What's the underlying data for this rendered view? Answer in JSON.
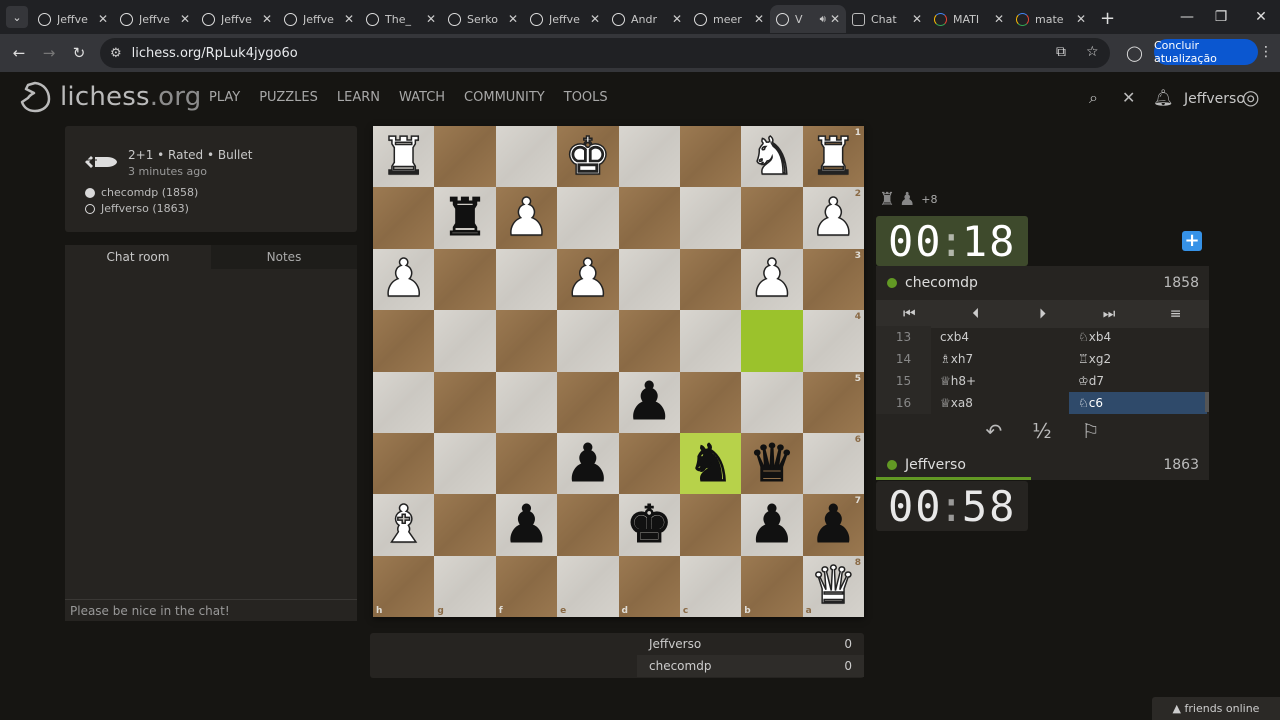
{
  "browser": {
    "tabs": [
      {
        "title": "Jeffve",
        "icon": "lichess-icon"
      },
      {
        "title": "Jeffve",
        "icon": "lichess-icon"
      },
      {
        "title": "Jeffve",
        "icon": "lichess-icon"
      },
      {
        "title": "Jeffve",
        "icon": "lichess-icon"
      },
      {
        "title": "The_",
        "icon": "lichess-icon"
      },
      {
        "title": "Serko",
        "icon": "lichess-icon"
      },
      {
        "title": "Jeffve",
        "icon": "lichess-icon"
      },
      {
        "title": "Andr",
        "icon": "lichess-icon"
      },
      {
        "title": "meer",
        "icon": "lichess-icon"
      },
      {
        "title": "V",
        "icon": "lichess-icon",
        "active": true,
        "audio": true
      },
      {
        "title": "Chat",
        "icon": "chatgpt-icon"
      },
      {
        "title": "MATI",
        "icon": "google-icon"
      },
      {
        "title": "mate",
        "icon": "google-icon"
      }
    ],
    "url": "lichess.org/RpLuk4jygo6o",
    "update_button": "Concluir atualização"
  },
  "site": {
    "logo": "lichess",
    "logo_suffix": ".org",
    "nav": [
      "PLAY",
      "PUZZLES",
      "LEARN",
      "WATCH",
      "COMMUNITY",
      "TOOLS"
    ],
    "username": "Jeffverso"
  },
  "game": {
    "info": "2+1 • Rated • Bullet",
    "time_ago": "3 minutes ago",
    "white_player": "checomdp (1858)",
    "black_player": "Jeffverso (1863)"
  },
  "chat": {
    "tabs": [
      "Chat room",
      "Notes"
    ],
    "placeholder": "Please be nice in the chat!"
  },
  "board": {
    "orientation": "black",
    "ranks": [
      "1",
      "2",
      "3",
      "4",
      "5",
      "6",
      "7",
      "8"
    ],
    "files": [
      "h",
      "g",
      "f",
      "e",
      "d",
      "c",
      "b",
      "a"
    ],
    "squares": [
      [
        "wR",
        "",
        "",
        "wK",
        "",
        "",
        "wN",
        "wR"
      ],
      [
        "",
        "bR",
        "wP",
        "",
        "",
        "",
        "",
        "wP"
      ],
      [
        "wP",
        "",
        "",
        "wP",
        "",
        "",
        "wP",
        ""
      ],
      [
        "",
        "",
        "",
        "",
        "",
        "",
        "",
        ""
      ],
      [
        "",
        "",
        "",
        "",
        "bP",
        "",
        "",
        ""
      ],
      [
        "",
        "",
        "",
        "bP",
        "",
        "bN",
        "bQ",
        ""
      ],
      [
        "wB",
        "",
        "bP",
        "",
        "bK",
        "",
        "bP",
        "bP"
      ],
      [
        "",
        "",
        "",
        "",
        "",
        "",
        "",
        "wQ"
      ]
    ],
    "highlights": [
      "b4",
      "c6"
    ]
  },
  "score": {
    "rows": [
      {
        "name": "Jeffverso",
        "score": "0"
      },
      {
        "name": "checomdp",
        "score": "0"
      }
    ]
  },
  "top_player": {
    "name": "checomdp",
    "rating": "1858",
    "clock_min": "00",
    "clock_sec": "18",
    "material": "+8",
    "captured": [
      "♜",
      "♟"
    ]
  },
  "bottom_player": {
    "name": "Jeffverso",
    "rating": "1863",
    "clock_min": "00",
    "clock_sec": "58"
  },
  "moves": [
    {
      "n": "13",
      "w": "cxb4",
      "b": "♘xb4"
    },
    {
      "n": "14",
      "w": "♗xh7",
      "b": "♖xg2"
    },
    {
      "n": "15",
      "w": "♕h8+",
      "b": "♔d7"
    },
    {
      "n": "16",
      "w": "♕xa8",
      "b": "♘c6",
      "current": "b"
    }
  ],
  "controls": {
    "first": "⏮",
    "prev": "⏴",
    "next": "⏵",
    "last": "⏭",
    "menu": "≡",
    "takeback": "↶",
    "draw": "½",
    "resign": "⚐"
  },
  "friends": "friends online",
  "colors": {
    "bg": "#161512",
    "panel": "#262421",
    "accent_green": "#629924",
    "highlight": "#9bc22c",
    "move_select": "#2f4a6a"
  }
}
